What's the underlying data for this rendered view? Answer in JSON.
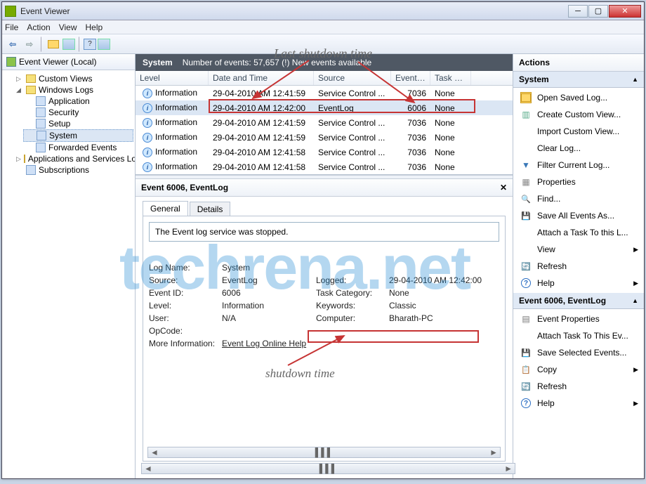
{
  "window": {
    "title": "Event Viewer"
  },
  "menu": {
    "file": "File",
    "action": "Action",
    "view": "View",
    "help": "Help"
  },
  "nav": {
    "root": "Event Viewer (Local)",
    "custom": "Custom Views",
    "winlogs": "Windows Logs",
    "app": "Application",
    "sec": "Security",
    "setup": "Setup",
    "system": "System",
    "fwd": "Forwarded Events",
    "appsvc": "Applications and Services Lo",
    "subs": "Subscriptions"
  },
  "center": {
    "hdr_left": "System",
    "hdr_right": "Number of events: 57,657 (!) New events available",
    "cols": {
      "level": "Level",
      "dt": "Date and Time",
      "src": "Source",
      "eid": "Event ID",
      "tc": "Task C..."
    },
    "rows": [
      {
        "level": "Information",
        "dt": "29-04-2010 AM 12:41:59",
        "src": "Service Control ...",
        "eid": "7036",
        "tc": "None"
      },
      {
        "level": "Information",
        "dt": "29-04-2010 AM 12:42:00",
        "src": "EventLog",
        "eid": "6006",
        "tc": "None"
      },
      {
        "level": "Information",
        "dt": "29-04-2010 AM 12:41:59",
        "src": "Service Control ...",
        "eid": "7036",
        "tc": "None"
      },
      {
        "level": "Information",
        "dt": "29-04-2010 AM 12:41:59",
        "src": "Service Control ...",
        "eid": "7036",
        "tc": "None"
      },
      {
        "level": "Information",
        "dt": "29-04-2010 AM 12:41:58",
        "src": "Service Control ...",
        "eid": "7036",
        "tc": "None"
      },
      {
        "level": "Information",
        "dt": "29-04-2010 AM 12:41:58",
        "src": "Service Control ...",
        "eid": "7036",
        "tc": "None"
      }
    ]
  },
  "detail": {
    "title": "Event 6006, EventLog",
    "tab_general": "General",
    "tab_details": "Details",
    "message": "The Event log service was stopped.",
    "props": {
      "logname_l": "Log Name:",
      "logname_v": "System",
      "source_l": "Source:",
      "source_v": "EventLog",
      "logged_l": "Logged:",
      "logged_v": "29-04-2010 AM 12:42:00",
      "eid_l": "Event ID:",
      "eid_v": "6006",
      "taskcat_l": "Task Category:",
      "taskcat_v": "None",
      "level_l": "Level:",
      "level_v": "Information",
      "keywords_l": "Keywords:",
      "keywords_v": "Classic",
      "user_l": "User:",
      "user_v": "N/A",
      "computer_l": "Computer:",
      "computer_v": "Bharath-PC",
      "opcode_l": "OpCode:",
      "opcode_v": "",
      "moreinfo_l": "More Information:",
      "moreinfo_v": "Event Log Online Help"
    }
  },
  "actions": {
    "hdr": "Actions",
    "sect1": "System",
    "sect2": "Event 6006, EventLog",
    "items1": [
      "Open Saved Log...",
      "Create Custom View...",
      "Import Custom View...",
      "Clear Log...",
      "Filter Current Log...",
      "Properties",
      "Find...",
      "Save All Events As...",
      "Attach a Task To this L...",
      "View",
      "Refresh",
      "Help"
    ],
    "items2": [
      "Event Properties",
      "Attach Task To This Ev...",
      "Save Selected Events...",
      "Copy",
      "Refresh",
      "Help"
    ]
  },
  "annotations": {
    "top": "Last shutdown time",
    "bottom": "shutdown time",
    "watermark": "techrena.net"
  }
}
